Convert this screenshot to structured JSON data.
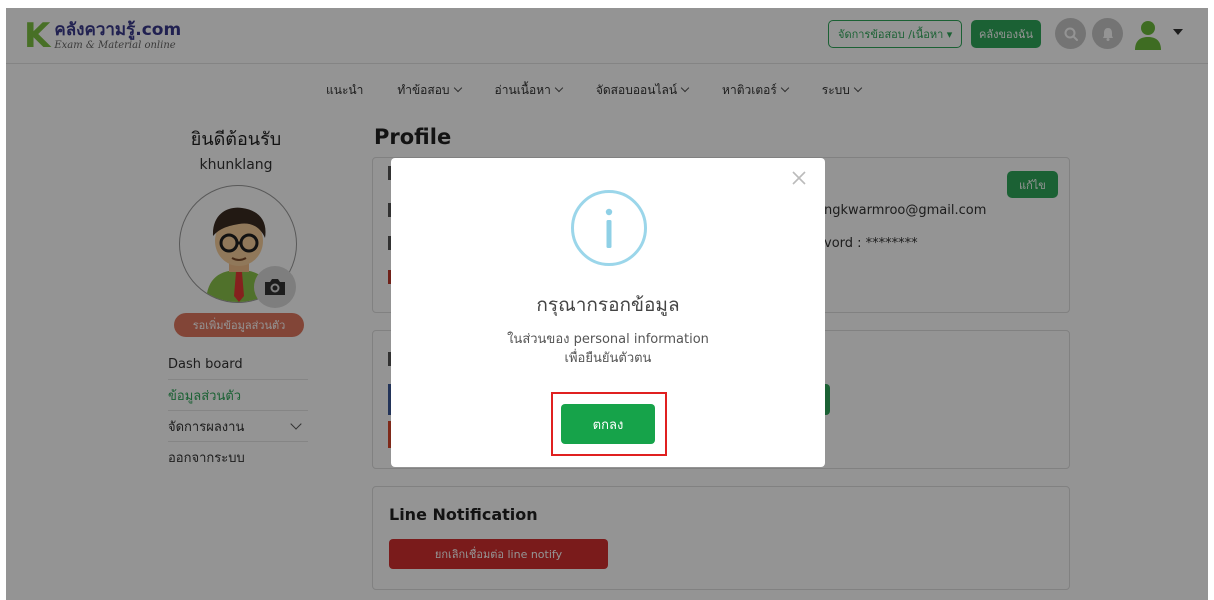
{
  "header": {
    "logo_main": "คลังความรู้.com",
    "logo_sub": "Exam & Material online",
    "manage_button": "จัดการข้อสอบ /เนื้อหา ▾",
    "my_library_button": "คลังของฉัน"
  },
  "nav": {
    "items": [
      {
        "label": "แนะนำ"
      },
      {
        "label": "ทำข้อสอบ"
      },
      {
        "label": "อ่านเนื้อหา"
      },
      {
        "label": "จัดสอบออนไลน์"
      },
      {
        "label": "หาติวเตอร์"
      },
      {
        "label": "ระบบ"
      }
    ]
  },
  "sidebar": {
    "welcome": "ยินดีต้อนรับ",
    "username": "khunklang",
    "pending_badge": "รอเพิ่มข้อมูลส่วนตัว",
    "menu": [
      {
        "label": "Dash board"
      },
      {
        "label": "ข้อมูลส่วนตัว"
      },
      {
        "label": "จัดการผลงาน"
      },
      {
        "label": "ออกจากระบบ"
      }
    ]
  },
  "main": {
    "title": "Profile",
    "edit_button": "แก้ไข",
    "email_partial": "ngkwarmroo@gmail.com",
    "password_partial": "vord : ********",
    "line_title": "Line Notification",
    "line_button": "ยกเลิกเชื่อมต่อ line notify"
  },
  "modal": {
    "title": "กรุณากรอกข้อมูล",
    "line1": "ในส่วนของ personal information",
    "line2": "เพื่อยืนยันตัวตน",
    "ok_button": "ตกลง"
  },
  "colors": {
    "brand_green": "#2fa85a",
    "ok_green": "#16a34a",
    "info_blue": "#9bd6ea",
    "highlight_red": "#e02020",
    "badge_orange": "#e0785f",
    "danger_red": "#d32f2f"
  },
  "icons": [
    "search-icon",
    "bell-icon",
    "user-icon",
    "camera-icon",
    "info-icon",
    "close-icon",
    "chevron-down-icon"
  ]
}
